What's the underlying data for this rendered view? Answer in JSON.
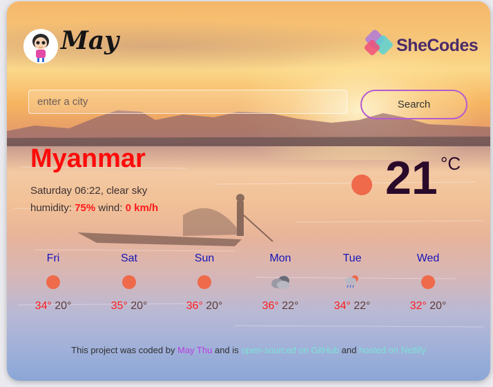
{
  "header": {
    "brand": "May",
    "logo_text": "SheCodes"
  },
  "search": {
    "placeholder": "enter a city",
    "value": "",
    "button_label": "Search"
  },
  "current": {
    "city": "Myanmar",
    "day_time": "Saturday 06:22",
    "description": "clear sky",
    "humidity_label": "humidity:",
    "humidity": "75%",
    "wind_label": "wind:",
    "wind": "0",
    "wind_unit": "km/h",
    "temperature": "21",
    "unit": "°C",
    "icon": "sun-icon"
  },
  "forecast": [
    {
      "day": "Fri",
      "max": "34°",
      "min": "20°",
      "icon": "sun-icon"
    },
    {
      "day": "Sat",
      "max": "35°",
      "min": "20°",
      "icon": "sun-icon"
    },
    {
      "day": "Sun",
      "max": "36°",
      "min": "20°",
      "icon": "sun-icon"
    },
    {
      "day": "Mon",
      "max": "36°",
      "min": "22°",
      "icon": "cloud-icon"
    },
    {
      "day": "Tue",
      "max": "34°",
      "min": "22°",
      "icon": "rain-cloud-icon"
    },
    {
      "day": "Wed",
      "max": "32°",
      "min": "20°",
      "icon": "sun-icon"
    }
  ],
  "footer": {
    "prefix": "This project was coded by",
    "author": "May Thu",
    "middle": "and is",
    "github_link": "open-sourced on GitHub",
    "and": "and",
    "netlify_link": "hosted on Netlify"
  },
  "colors": {
    "accent_red": "#ff0a0a",
    "day_blue": "#1414b8",
    "search_border": "#b45ad0",
    "sun": "#ee6a4a"
  }
}
